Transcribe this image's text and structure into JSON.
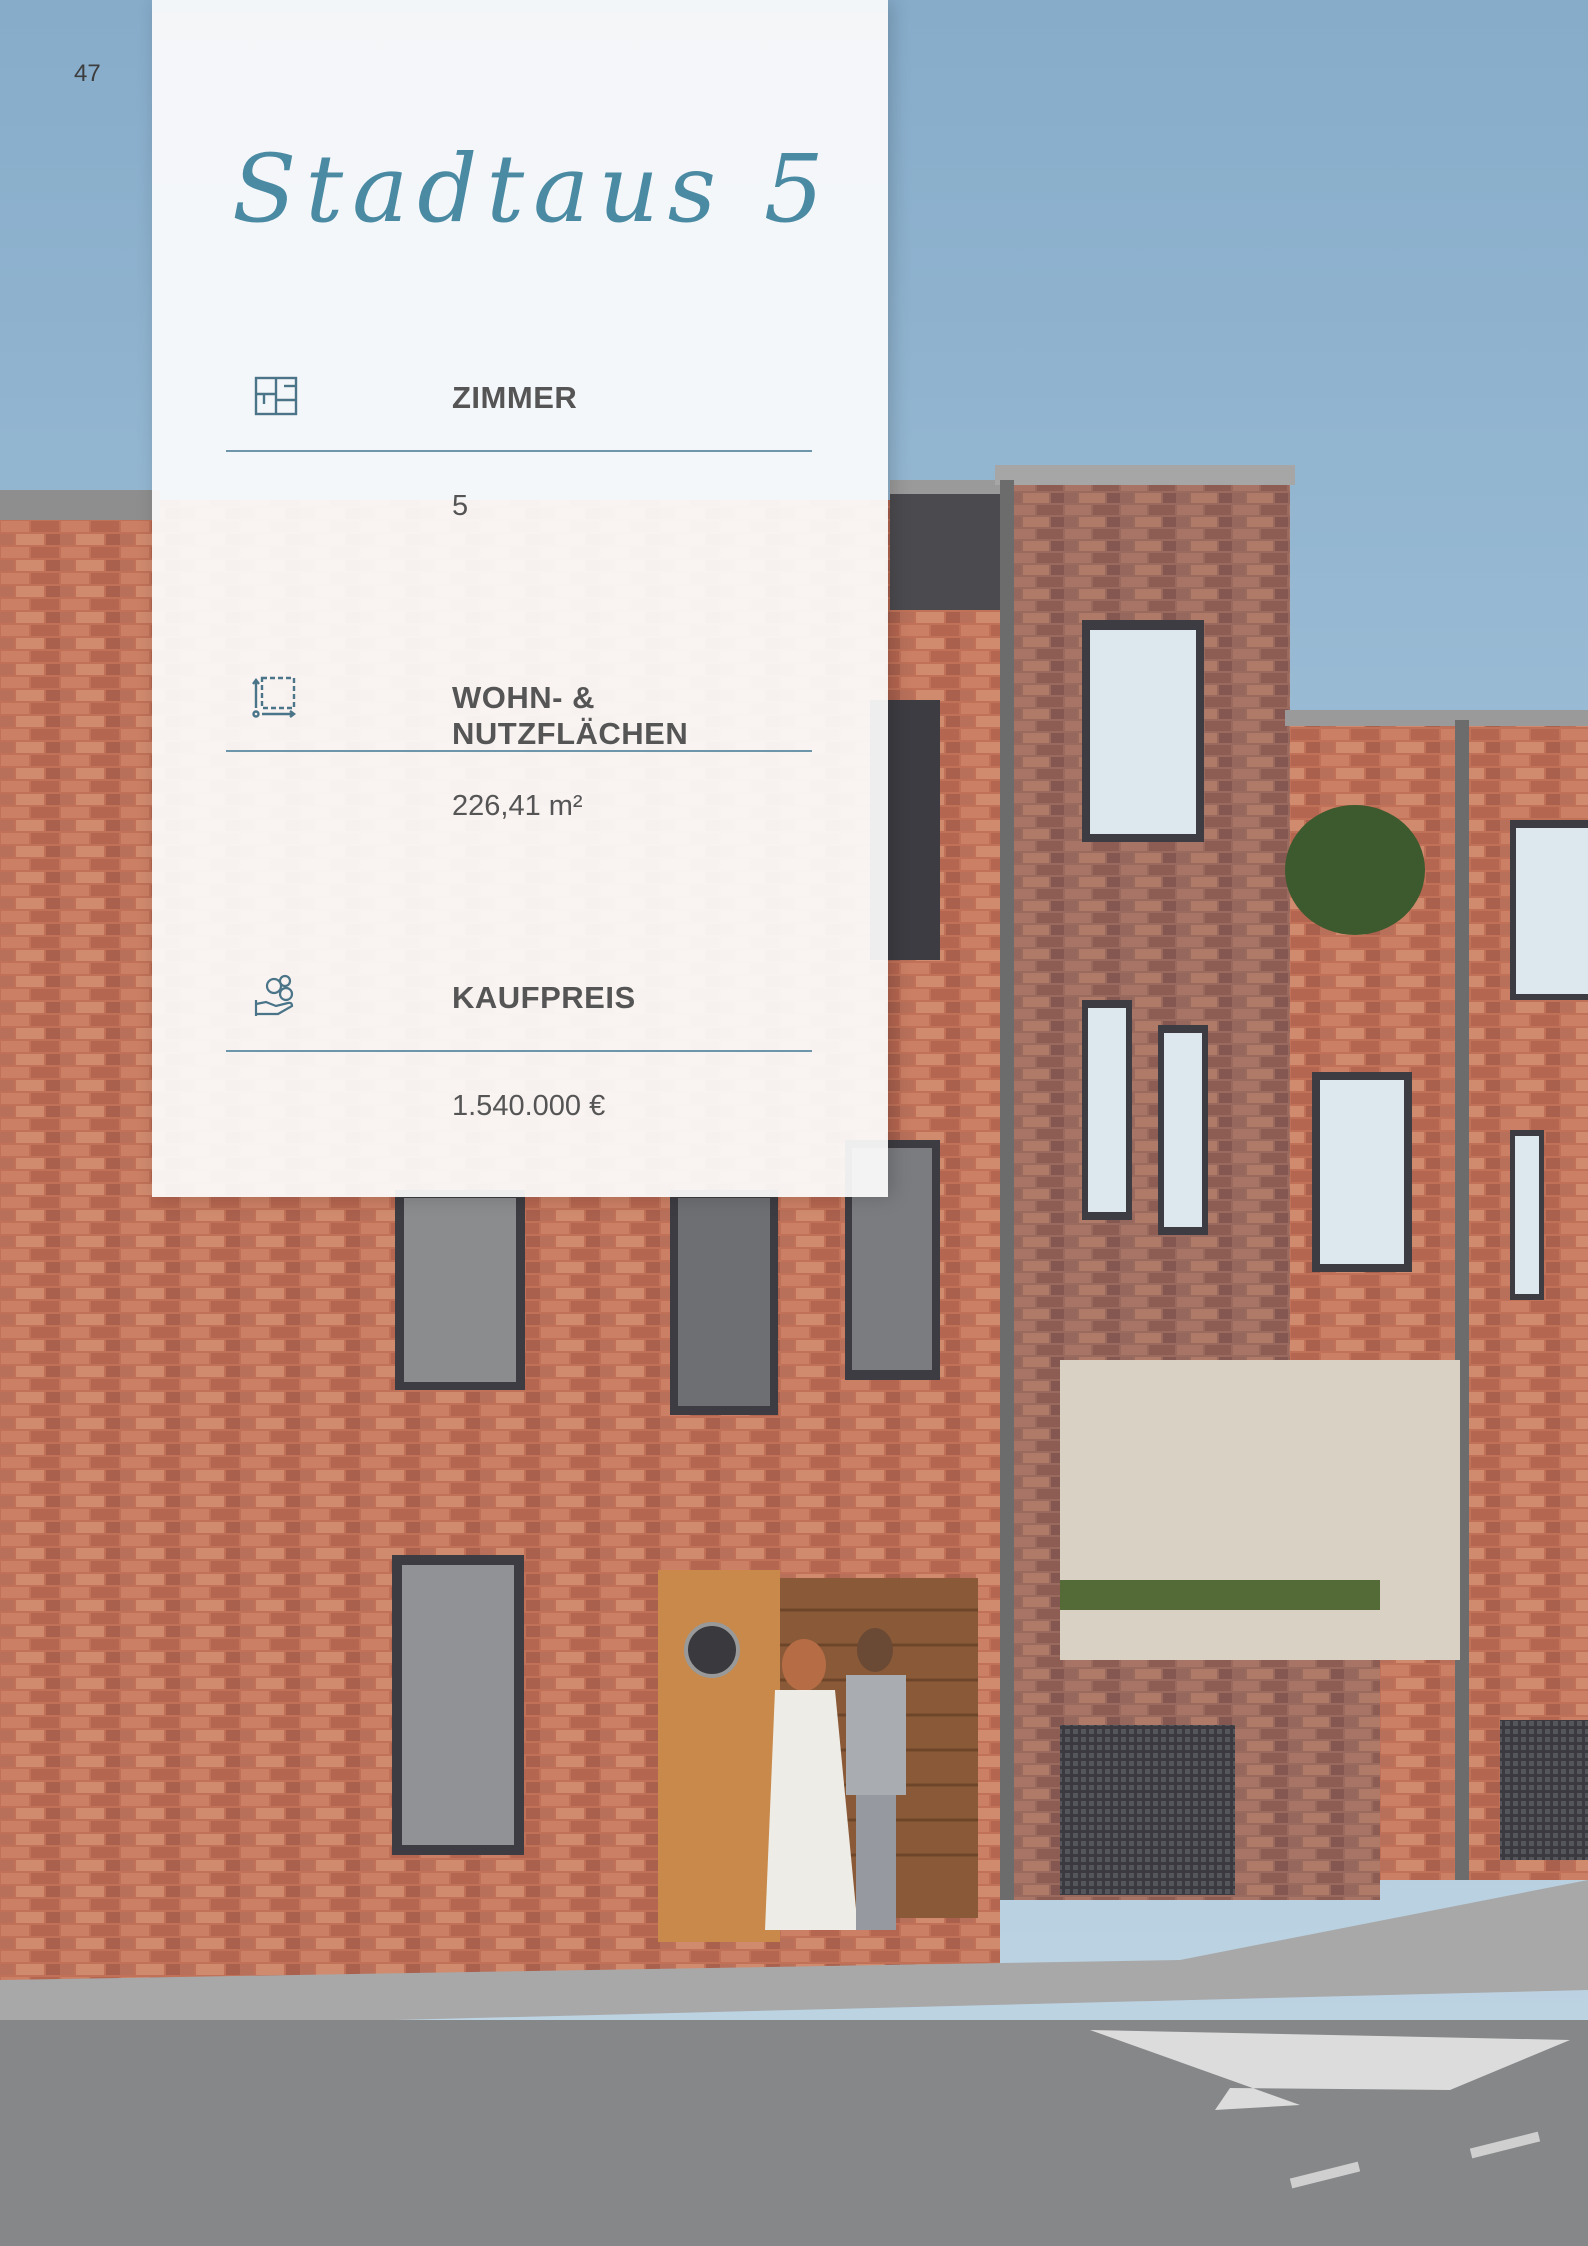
{
  "page": {
    "number": "47"
  },
  "panel": {
    "title": "Stadtaus 5",
    "features": [
      {
        "icon": "floor-plan-icon",
        "label": "ZIMMER",
        "value": "5"
      },
      {
        "icon": "area-measure-icon",
        "label": "WOHN- & NUTZFLÄCHEN",
        "value": "226,41 m²"
      },
      {
        "icon": "price-hand-coins-icon",
        "label": "KAUFPREIS",
        "value": "1.540.000 €"
      }
    ]
  },
  "colors": {
    "accent": "#4a8aa3",
    "divider": "#6e96aa",
    "text": "#555555"
  }
}
